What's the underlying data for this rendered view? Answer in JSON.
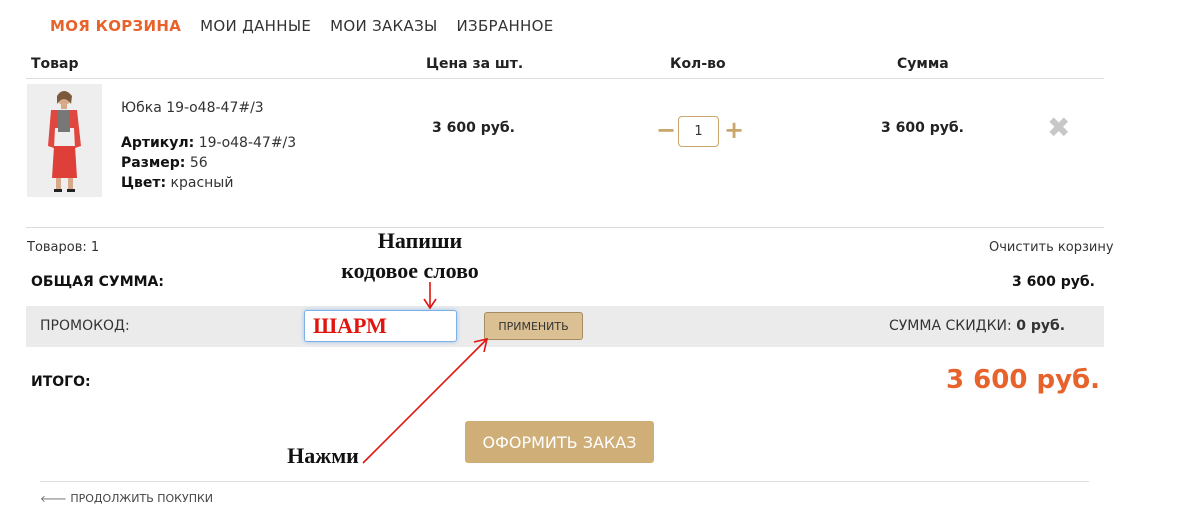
{
  "tabs": [
    {
      "label": "МОЯ КОРЗИНА"
    },
    {
      "label": "МОИ ДАННЫЕ"
    },
    {
      "label": "МОИ ЗАКАЗЫ"
    },
    {
      "label": "ИЗБРАННОЕ"
    }
  ],
  "table_headers": {
    "product": "Товар",
    "unit_price": "Цена за шт.",
    "qty": "Кол-во",
    "sum": "Сумма"
  },
  "item": {
    "name": "Юбка 19-о48-47#/3",
    "article_label": "Артикул:",
    "article": "19-о48-47#/3",
    "size_label": "Размер:",
    "size": "56",
    "color_label": "Цвет:",
    "color": "красный",
    "price": "3 600 руб.",
    "quantity": "1",
    "sum": "3 600 руб."
  },
  "icons": {
    "minus": "−",
    "plus": "+",
    "remove": "✖",
    "back": "🡐"
  },
  "summary": {
    "items_count": "Товаров: 1",
    "clear_cart": "Очистить корзину",
    "total_label": "ОБЩАЯ СУММА:",
    "total_value": "3 600 руб."
  },
  "promo": {
    "label": "ПРОМОКОД:",
    "value": "ШАРМ",
    "apply": "ПРИМЕНИТЬ",
    "discount_label": "СУММА СКИДКИ:",
    "discount_value": "0 руб."
  },
  "final": {
    "label": "ИТОГО:",
    "value": "3 600 руб.",
    "order_button": "ОФОРМИТЬ ЗАКАЗ"
  },
  "annotations": {
    "write_line1": "Напиши",
    "write_line2": "кодовое слово",
    "press": "Нажми"
  },
  "footer": {
    "continue": "ПРОДОЛЖИТЬ ПОКУПКИ"
  },
  "colors": {
    "accent": "#e8632c",
    "gold": "#cfae78",
    "annotation_red": "#e0150f"
  }
}
